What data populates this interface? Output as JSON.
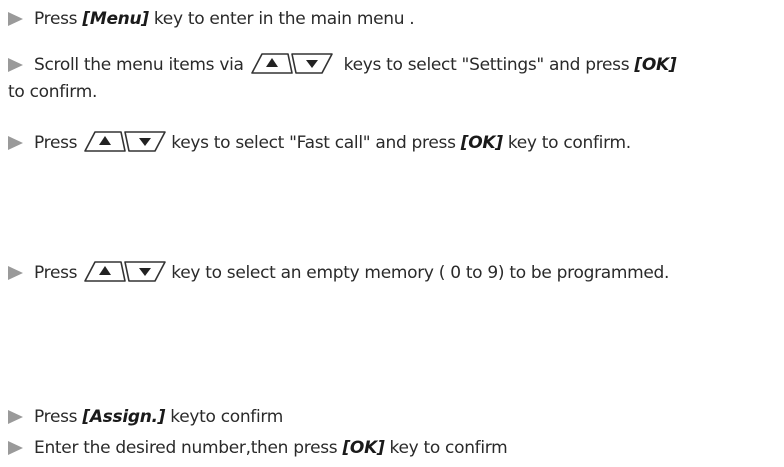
{
  "steps": [
    {
      "before": "Press ",
      "key": "[Menu]",
      "after": " key to enter in the main menu ."
    },
    {
      "before": "Scroll the menu items via",
      "after_nav": "keys to select \"Settings\" and press ",
      "key": "[OK]",
      "line2": "to confirm."
    },
    {
      "before": "Press",
      "after_nav": "keys to select  \"Fast call\" and press ",
      "key": "[OK]",
      "after": "  key to confirm."
    },
    {
      "before": "Press",
      "after_nav": "key to select an empty memory ( 0 to 9) to be programmed."
    },
    {
      "before": "Press ",
      "key": "[Assign.]",
      "after": " keyto confirm"
    },
    {
      "before": "Enter the desired number,then press ",
      "key": "[OK]",
      "after": " key to confirm"
    }
  ],
  "icons": {
    "bullet": "triangle-bullet-icon",
    "up": "up-arrow-key-icon",
    "down": "down-arrow-key-icon"
  },
  "colors": {
    "bullet": "#9a9a9a",
    "text": "#2a2a2a"
  }
}
